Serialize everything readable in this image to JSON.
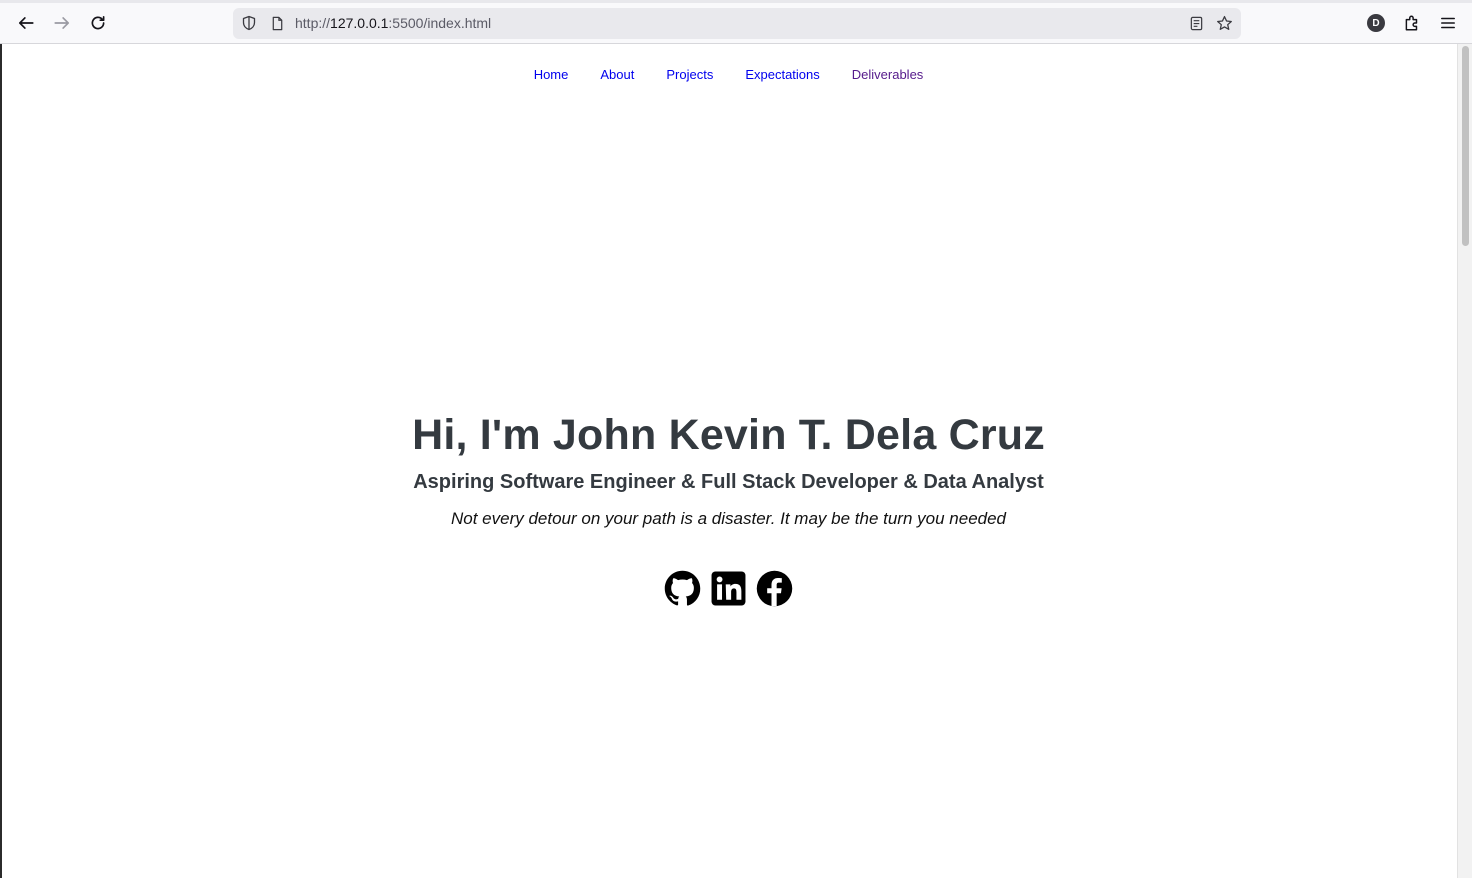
{
  "browser": {
    "url_scheme": "http://",
    "url_host": "127.0.0.1",
    "url_rest": ":5500/index.html",
    "profile_initial": "D"
  },
  "nav": {
    "items": [
      {
        "label": "Home",
        "visited": false
      },
      {
        "label": "About",
        "visited": false
      },
      {
        "label": "Projects",
        "visited": false
      },
      {
        "label": "Expectations",
        "visited": false
      },
      {
        "label": "Deliverables",
        "visited": true
      }
    ]
  },
  "hero": {
    "title": "Hi, I'm John Kevin T. Dela Cruz",
    "subtitle": "Aspiring Software Engineer & Full Stack Developer & Data Analyst",
    "quote": "Not every detour on your path is a disaster. It may be the turn you needed"
  },
  "socials": [
    "github-icon",
    "linkedin-icon",
    "facebook-icon"
  ],
  "colors": {
    "heading": "#343a40",
    "link": "#0000ee",
    "visited_link": "#551a8b"
  }
}
